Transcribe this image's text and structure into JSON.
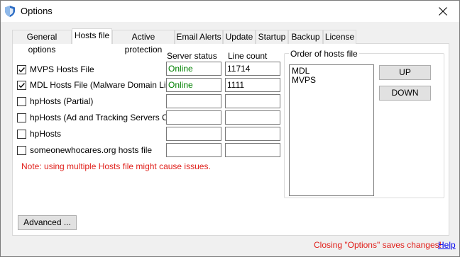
{
  "window": {
    "title": "Options",
    "icon": "shield-icon",
    "close_icon": "close-icon"
  },
  "tabs": [
    {
      "label": "General options"
    },
    {
      "label": "Hosts file",
      "active": true
    },
    {
      "label": "Active protection"
    },
    {
      "label": "Email Alerts"
    },
    {
      "label": "Update"
    },
    {
      "label": "Startup"
    },
    {
      "label": "Backup"
    },
    {
      "label": "License"
    }
  ],
  "columns": {
    "server_status": "Server status",
    "line_count": "Line count"
  },
  "hosts": [
    {
      "label": "MVPS Hosts File",
      "checked": true,
      "status": "Online",
      "count": "11714"
    },
    {
      "label": "MDL Hosts File (Malware Domain List)",
      "checked": true,
      "status": "Online",
      "count": "1111"
    },
    {
      "label": "hpHosts (Partial)",
      "checked": false,
      "status": "",
      "count": ""
    },
    {
      "label": "hpHosts (Ad and Tracking Servers Only)",
      "checked": false,
      "status": "",
      "count": ""
    },
    {
      "label": "hpHosts",
      "checked": false,
      "status": "",
      "count": ""
    },
    {
      "label": "someonewhocares.org hosts file",
      "checked": false,
      "status": "",
      "count": ""
    }
  ],
  "note": "Note: using multiple Hosts file might cause issues.",
  "order": {
    "title": "Order of hosts file",
    "items": [
      "MDL",
      "MVPS"
    ],
    "up_label": "UP",
    "down_label": "DOWN"
  },
  "advanced_label": "Advanced ...",
  "footer": {
    "note": "Closing \"Options\" saves changes!",
    "help": "Help"
  },
  "colors": {
    "status_online": "#008000",
    "warning": "#e0201b",
    "link": "#0000ee"
  }
}
